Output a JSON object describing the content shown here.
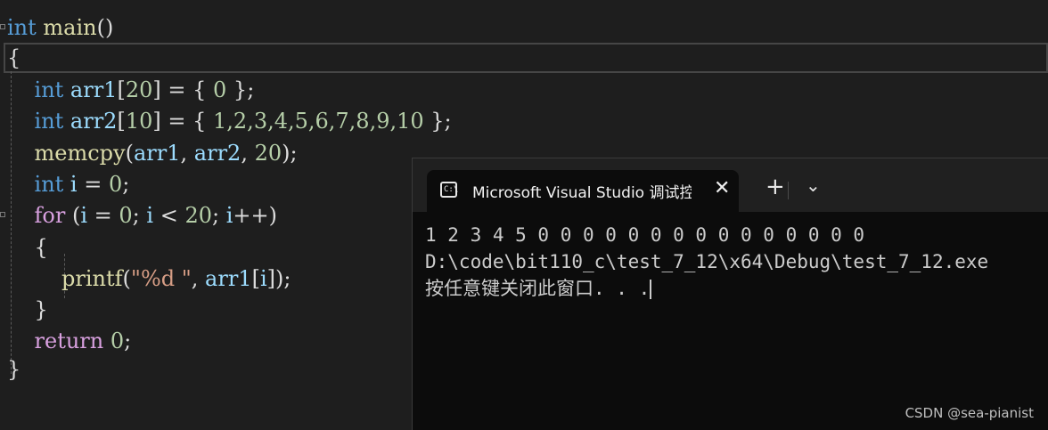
{
  "editor": {
    "lines": [
      [
        {
          "t": "int",
          "c": "kw"
        },
        {
          "t": " main",
          "c": "fn"
        },
        {
          "t": "()",
          "c": "punc"
        }
      ],
      [
        {
          "t": "{",
          "c": "punc"
        }
      ],
      [
        {
          "t": "    int",
          "c": "kw"
        },
        {
          "t": " arr1",
          "c": "var"
        },
        {
          "t": "[",
          "c": "punc"
        },
        {
          "t": "20",
          "c": "num"
        },
        {
          "t": "] = { ",
          "c": "punc"
        },
        {
          "t": "0",
          "c": "num"
        },
        {
          "t": " };",
          "c": "punc"
        }
      ],
      [
        {
          "t": "    int",
          "c": "kw"
        },
        {
          "t": " arr2",
          "c": "var"
        },
        {
          "t": "[",
          "c": "punc"
        },
        {
          "t": "10",
          "c": "num"
        },
        {
          "t": "] = { ",
          "c": "punc"
        },
        {
          "t": "1,2,3,4,5,6,7,8,9,10",
          "c": "num"
        },
        {
          "t": " };",
          "c": "punc"
        }
      ],
      [
        {
          "t": "    memcpy",
          "c": "fn"
        },
        {
          "t": "(",
          "c": "punc"
        },
        {
          "t": "arr1",
          "c": "var"
        },
        {
          "t": ", ",
          "c": "punc"
        },
        {
          "t": "arr2",
          "c": "var"
        },
        {
          "t": ", ",
          "c": "punc"
        },
        {
          "t": "20",
          "c": "num"
        },
        {
          "t": ");",
          "c": "punc"
        }
      ],
      [
        {
          "t": "    int",
          "c": "kw"
        },
        {
          "t": " i",
          "c": "var"
        },
        {
          "t": " = ",
          "c": "punc"
        },
        {
          "t": "0",
          "c": "num"
        },
        {
          "t": ";",
          "c": "punc"
        }
      ],
      [
        {
          "t": "    for",
          "c": "ctrl"
        },
        {
          "t": " (",
          "c": "punc"
        },
        {
          "t": "i",
          "c": "var"
        },
        {
          "t": " = ",
          "c": "punc"
        },
        {
          "t": "0",
          "c": "num"
        },
        {
          "t": "; ",
          "c": "punc"
        },
        {
          "t": "i",
          "c": "var"
        },
        {
          "t": " < ",
          "c": "punc"
        },
        {
          "t": "20",
          "c": "num"
        },
        {
          "t": "; ",
          "c": "punc"
        },
        {
          "t": "i",
          "c": "var"
        },
        {
          "t": "++)",
          "c": "punc"
        }
      ],
      [
        {
          "t": "    {",
          "c": "punc"
        }
      ],
      [
        {
          "t": "        printf",
          "c": "fn"
        },
        {
          "t": "(",
          "c": "punc"
        },
        {
          "t": "\"%d \"",
          "c": "str"
        },
        {
          "t": ", ",
          "c": "punc"
        },
        {
          "t": "arr1",
          "c": "var"
        },
        {
          "t": "[",
          "c": "punc"
        },
        {
          "t": "i",
          "c": "var"
        },
        {
          "t": "]);",
          "c": "punc"
        }
      ],
      [
        {
          "t": "    }",
          "c": "punc"
        }
      ],
      [
        {
          "t": "    return",
          "c": "ctrl"
        },
        {
          "t": " ",
          "c": "punc"
        },
        {
          "t": "0",
          "c": "num"
        },
        {
          "t": ";",
          "c": "punc"
        }
      ],
      [
        {
          "t": "}",
          "c": "punc"
        }
      ]
    ]
  },
  "console": {
    "tab_title": "Microsoft Visual Studio 调试控制台",
    "tab_icon_glyph": "C:\\",
    "close_glyph": "✕",
    "new_tab_glyph": "+",
    "dropdown_glyph": "⌄",
    "output_line1": "1 2 3 4 5 0 0 0 0 0 0 0 0 0 0 0 0 0 0 0",
    "output_line2": "D:\\code\\bit110_c\\test_7_12\\x64\\Debug\\test_7_12.exe",
    "output_line3": "按任意键关闭此窗口. . ."
  },
  "watermark": "CSDN @sea-pianist"
}
